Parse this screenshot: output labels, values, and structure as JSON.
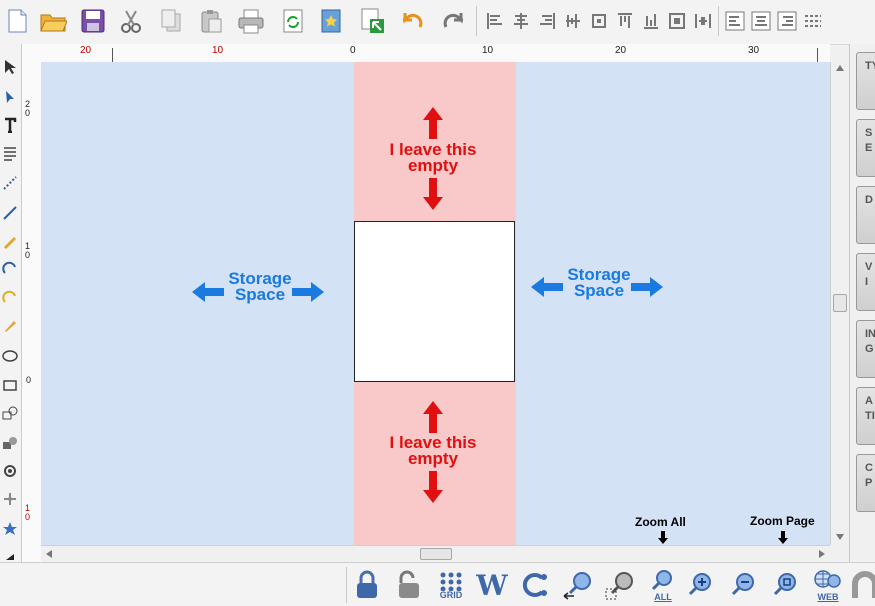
{
  "toolbar": {
    "icons": [
      "new-document",
      "open-folder",
      "save",
      "cut",
      "copy",
      "paste",
      "print",
      "refresh",
      "bookmark",
      "export",
      "undo",
      "redo",
      "align-left",
      "align-center",
      "align-right",
      "align-vertical-center",
      "align-middle",
      "align-top",
      "align-bottom",
      "distribute",
      "distribute-horizontal",
      "align-page-left",
      "align-page-center",
      "align-page-right",
      "distribute-vertical"
    ]
  },
  "ruler": {
    "top_labels": [
      "20",
      "10",
      "0",
      "10",
      "20",
      "30"
    ],
    "left_labels": [
      "2\n0",
      "1\n0",
      "0",
      "1\n0"
    ]
  },
  "canvas": {
    "top_text_line1": "I leave this",
    "top_text_line2": "empty",
    "bottom_text_line1": "I leave this",
    "bottom_text_line2": "empty",
    "left_storage_line1": "Storage",
    "left_storage_line2": "Space",
    "right_storage_line1": "Storage",
    "right_storage_line2": "Space",
    "zoom_all_label": "Zoom All",
    "zoom_page_label": "Zoom Page",
    "colors": {
      "storage": "#d3e2f5",
      "empty_zone": "#f9c8c8",
      "red_text": "#e01010",
      "blue_text": "#1a7ae0"
    }
  },
  "right_panel": {
    "buttons": [
      "TY",
      "S\nE",
      "D",
      "V\nI",
      "IN\nG",
      "A\nTI",
      "C\nP"
    ]
  },
  "bottom_bar": {
    "grid_label": "GRID",
    "w_label": "W",
    "all_label": "ALL",
    "web_label": "WEB"
  }
}
